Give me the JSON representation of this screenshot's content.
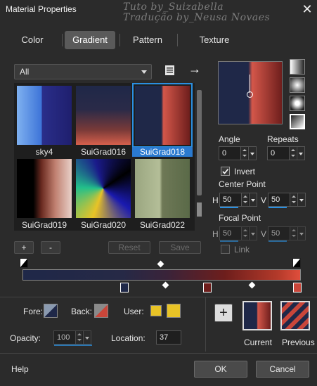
{
  "window": {
    "title": "Material Properties",
    "close_glyph": "✕"
  },
  "watermark": {
    "line1": "Tuto by_Suizabella",
    "line2": "Tradução by_Neusa Novaes"
  },
  "tabs": [
    {
      "label": "Color",
      "active": false
    },
    {
      "label": "Gradient",
      "active": true
    },
    {
      "label": "Pattern",
      "active": false
    },
    {
      "label": "Texture",
      "active": false
    }
  ],
  "filter": {
    "value": "All"
  },
  "icons": {
    "library": "book-icon",
    "arrow": "→"
  },
  "gradients": [
    {
      "name": "sky4",
      "selected": false
    },
    {
      "name": "SuiGrad016",
      "selected": false
    },
    {
      "name": "SuiGrad018",
      "selected": true
    },
    {
      "name": "SuiGrad019",
      "selected": false
    },
    {
      "name": "SuiGrad020",
      "selected": false
    },
    {
      "name": "SuiGrad022",
      "selected": false
    }
  ],
  "list_buttons": {
    "add": "+",
    "remove": "-",
    "reset": "Reset",
    "save": "Save"
  },
  "angle": {
    "label": "Angle",
    "value": "0"
  },
  "repeats": {
    "label": "Repeats",
    "value": "0"
  },
  "invert": {
    "label": "Invert",
    "checked": true
  },
  "center_point": {
    "label": "Center Point",
    "h_label": "H",
    "h": "50",
    "v_label": "V",
    "v": "50"
  },
  "focal_point": {
    "label": "Focal Point",
    "h_label": "H",
    "h": "50",
    "v_label": "V",
    "v": "50"
  },
  "link": {
    "label": "Link",
    "checked": false
  },
  "colors": {
    "navy": "#1f2848",
    "red": "#c9463a",
    "darkred": "#6e1e1c",
    "yellow": "#e8c326"
  },
  "bottom": {
    "fore_label": "Fore:",
    "back_label": "Back:",
    "user_label": "User:",
    "opacity_label": "Opacity:",
    "opacity": "100",
    "location_label": "Location:",
    "location": "37",
    "add_glyph": "+",
    "current_label": "Current",
    "previous_label": "Previous"
  },
  "footer": {
    "help": "Help",
    "ok": "OK",
    "cancel": "Cancel"
  }
}
